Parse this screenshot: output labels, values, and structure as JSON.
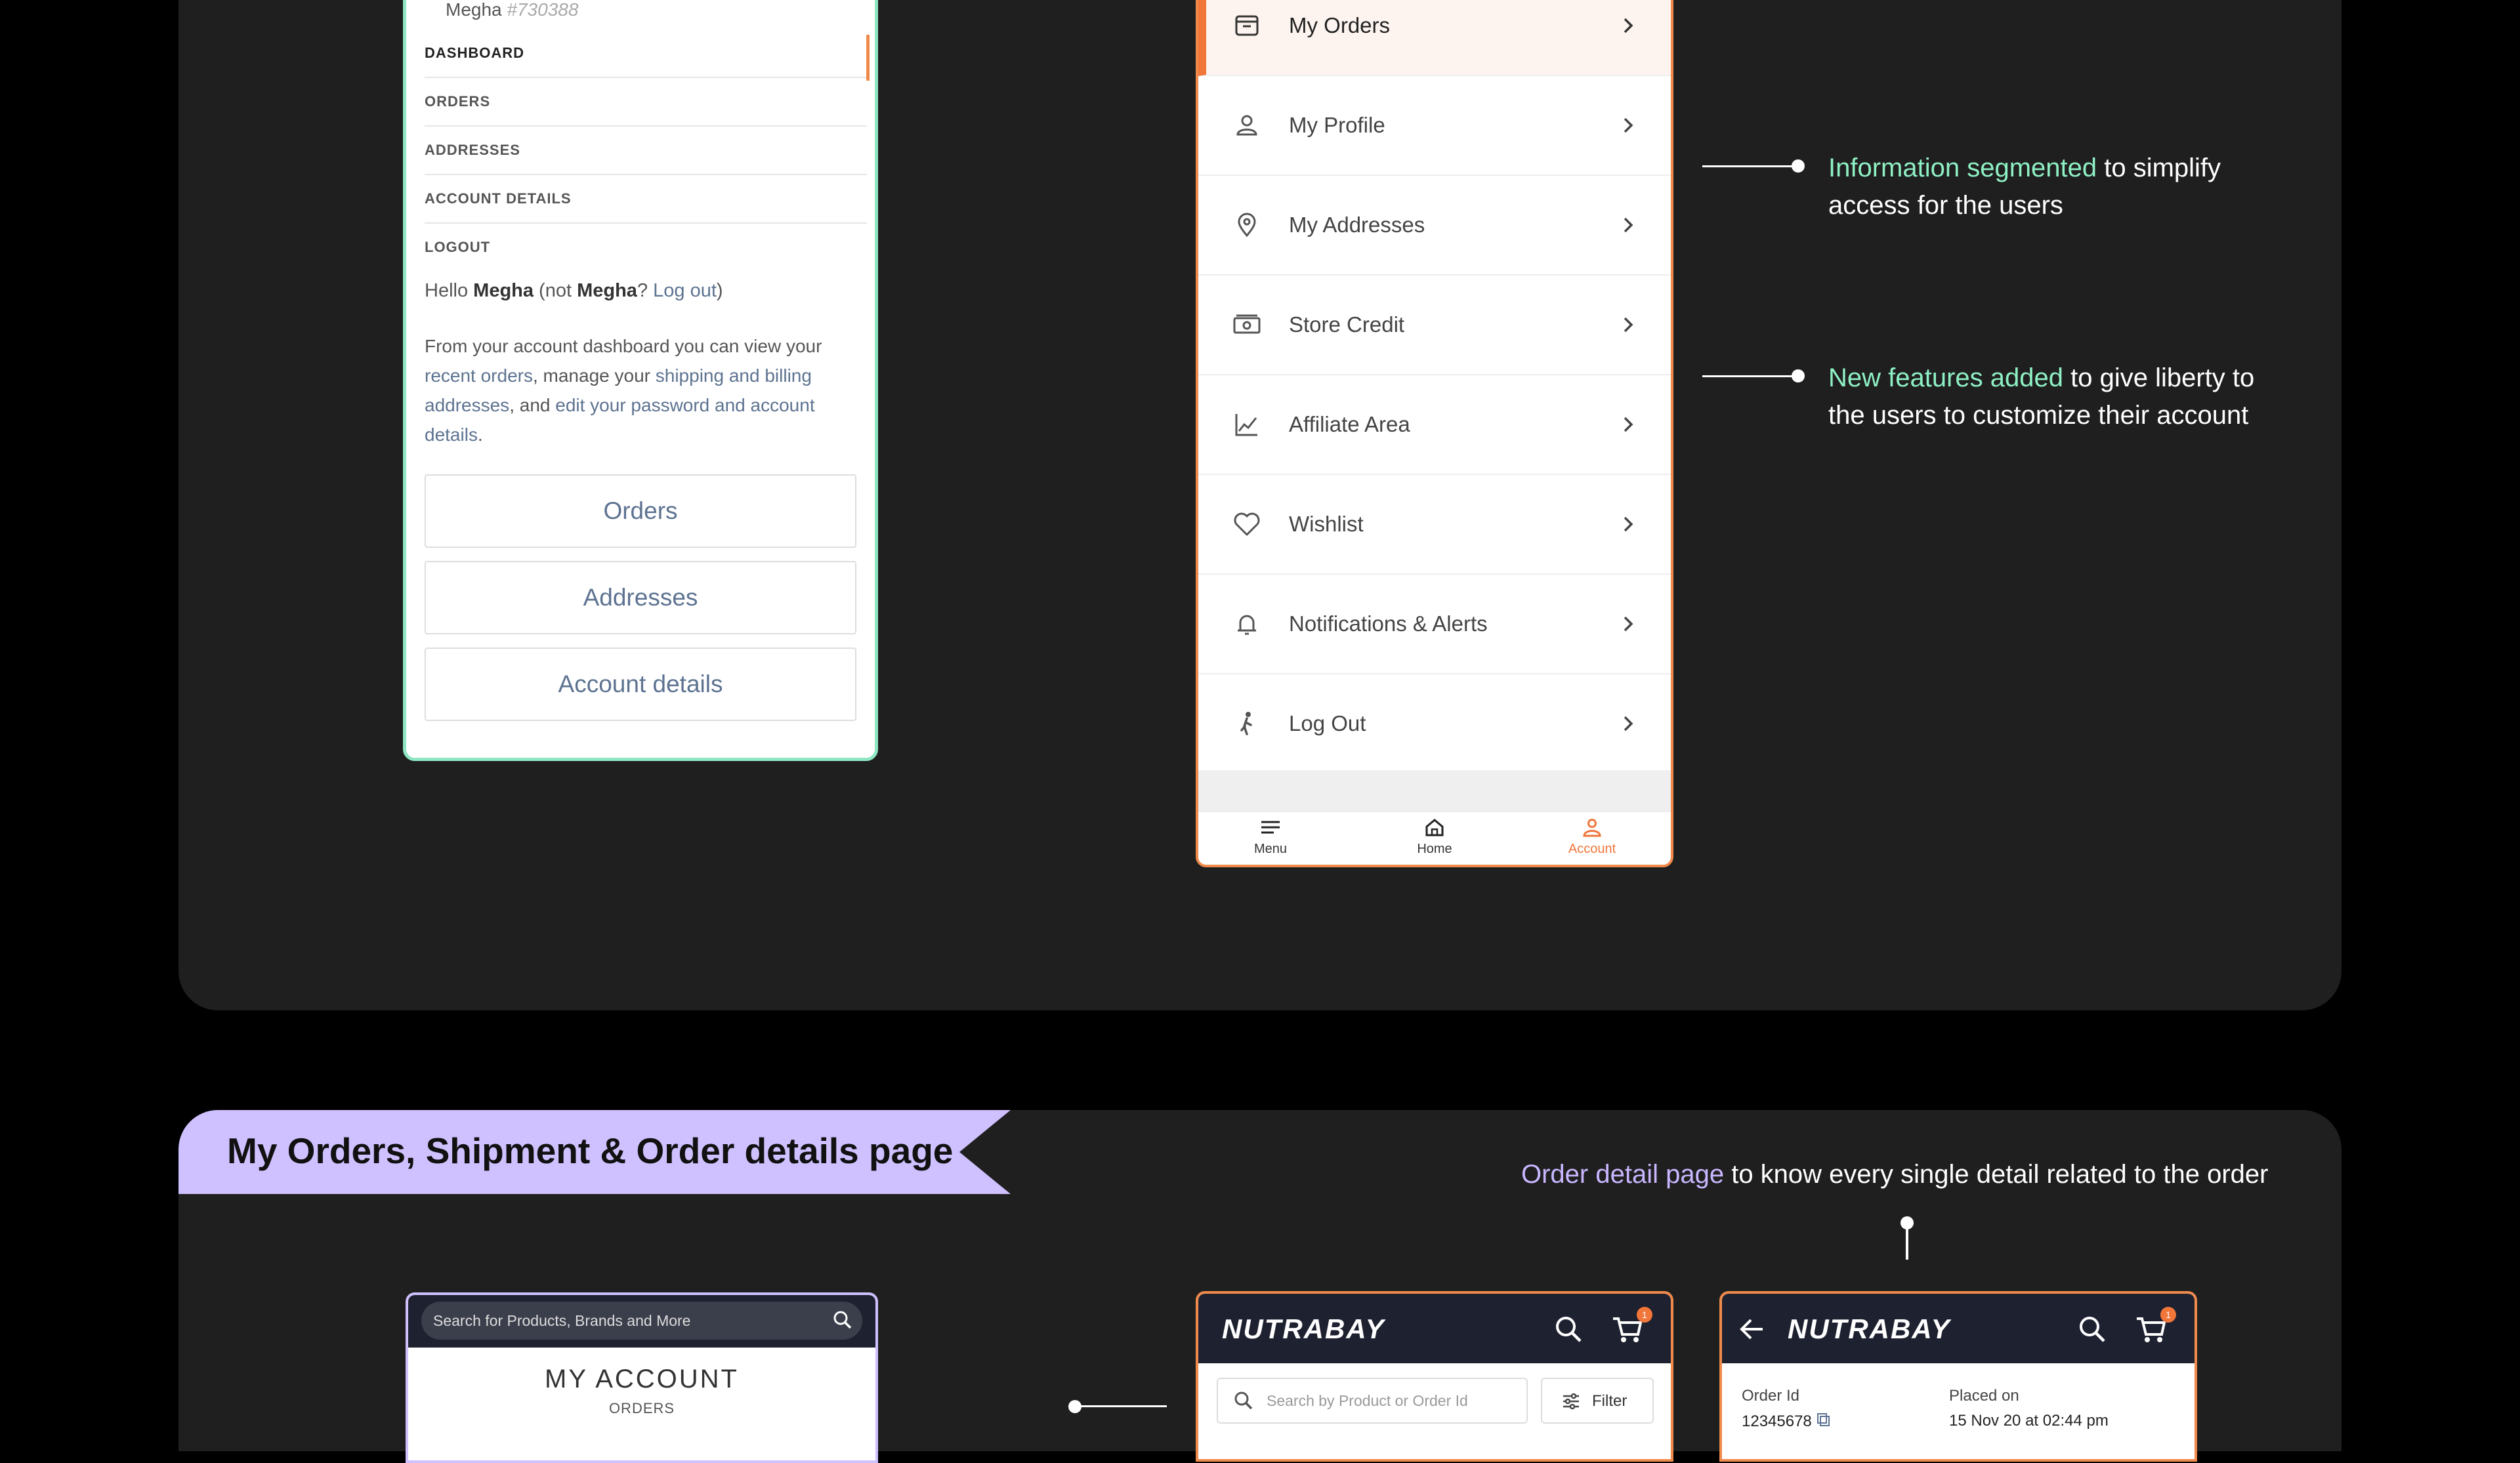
{
  "old_dashboard": {
    "user_name": "Megha",
    "user_id": "#730388",
    "nav": [
      "DASHBOARD",
      "ORDERS",
      "ADDRESSES",
      "ACCOUNT DETAILS",
      "LOGOUT"
    ],
    "hello": {
      "prefix": "Hello ",
      "name": "Megha",
      "mid": " (not ",
      "name2": "Megha",
      "q": "? ",
      "logout": "Log out",
      "close": ")"
    },
    "para": {
      "p1": "From your account dashboard you can view your ",
      "l1": "recent orders",
      "p2": ", manage your ",
      "l2": "shipping and billing addresses",
      "p3": ", and ",
      "l3": "edit your password and account details",
      "p4": "."
    },
    "buttons": [
      "Orders",
      "Addresses",
      "Account details"
    ]
  },
  "new_menu": {
    "items": [
      {
        "label": "My Orders",
        "icon": "orders-box-icon"
      },
      {
        "label": "My Profile",
        "icon": "user-icon"
      },
      {
        "label": "My Addresses",
        "icon": "location-pin-icon"
      },
      {
        "label": "Store Credit",
        "icon": "cash-icon"
      },
      {
        "label": "Affiliate Area",
        "icon": "chart-line-icon"
      },
      {
        "label": "Wishlist",
        "icon": "heart-icon"
      },
      {
        "label": "Notifications & Alerts",
        "icon": "bell-icon"
      },
      {
        "label": "Log Out",
        "icon": "walking-person-icon"
      }
    ],
    "bottom_nav": [
      "Menu",
      "Home",
      "Account"
    ]
  },
  "annotations": {
    "a1": {
      "highlight": "Information segmented",
      "rest1": " to simplify",
      "line2": "access for the users"
    },
    "a2": {
      "highlight": "New features added",
      "rest1": " to give liberty to",
      "line2": "the users to customize their account"
    },
    "a3": {
      "highlight": "Order detail page",
      "rest": " to know every single detail related to the order"
    }
  },
  "section": {
    "title": "My Orders, Shipment & Order details page"
  },
  "bottom_phones": {
    "a": {
      "search_placeholder": "Search for Products, Brands and More",
      "title": "MY ACCOUNT",
      "subtitle": "ORDERS"
    },
    "b": {
      "logo": "NUTRABAY",
      "cart_count": "1",
      "search_placeholder": "Search by Product or Order Id",
      "filter": "Filter"
    },
    "c": {
      "logo": "NUTRABAY",
      "cart_count": "1",
      "order_id_label": "Order Id",
      "order_id_value": "12345678",
      "placed_label": "Placed on",
      "placed_value": "15 Nov 20 at 02:44 pm"
    }
  },
  "colors": {
    "accent_orange": "#f0763a",
    "green_highlight": "#8ef0c4",
    "purple_highlight": "#c9b6ff",
    "panel_bg": "#1f1f1f"
  }
}
